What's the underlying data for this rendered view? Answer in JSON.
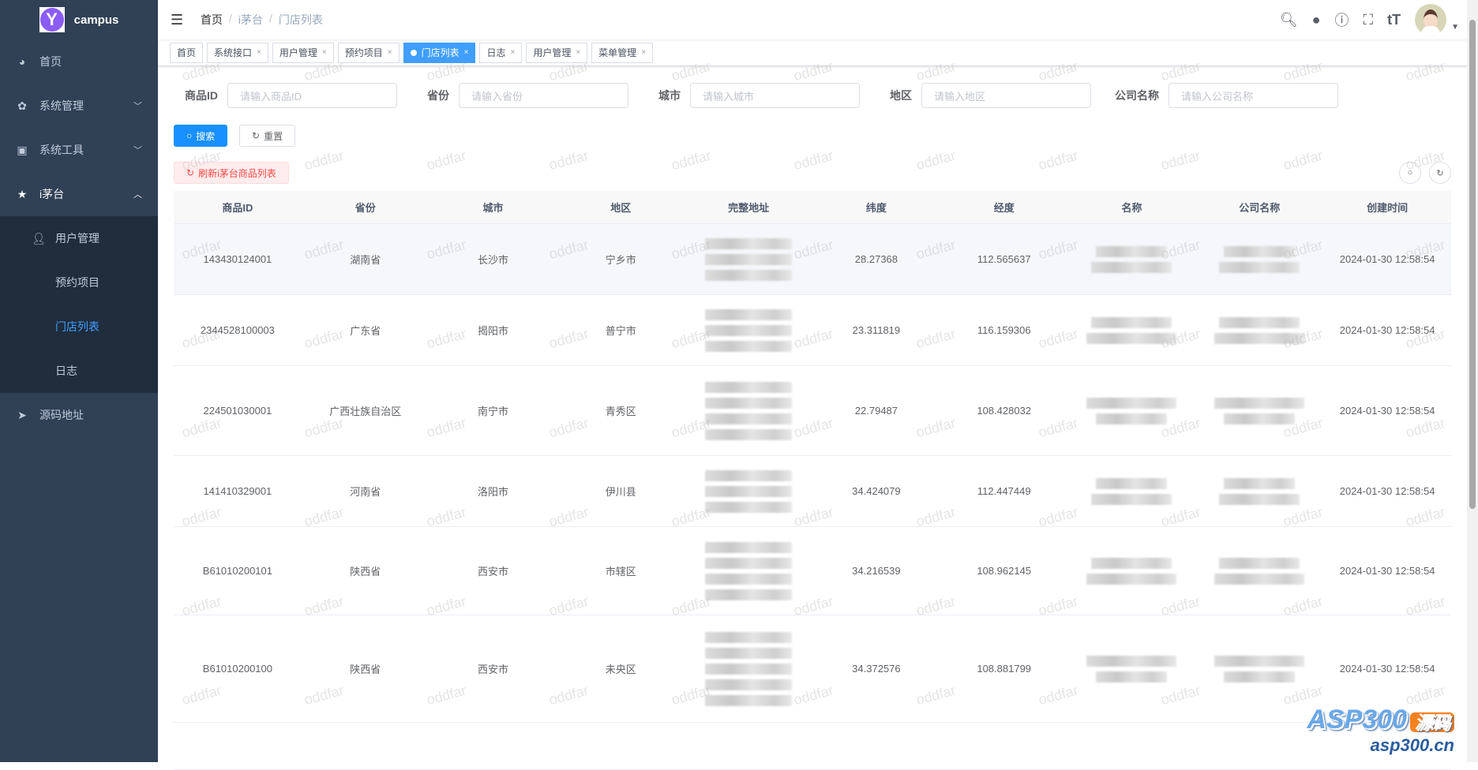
{
  "app": {
    "title": "campus",
    "logo_letter": "Y"
  },
  "sidebar": {
    "items": [
      {
        "label": "首页",
        "icon": "dashboard-icon"
      },
      {
        "label": "系统管理",
        "icon": "gear-icon"
      },
      {
        "label": "系统工具",
        "icon": "toolbox-icon"
      },
      {
        "label": "i茅台",
        "icon": "star-icon"
      },
      {
        "label": "源码地址",
        "icon": "send-icon"
      }
    ],
    "submenu": [
      {
        "label": "用户管理"
      },
      {
        "label": "预约项目"
      },
      {
        "label": "门店列表"
      },
      {
        "label": "日志"
      }
    ]
  },
  "breadcrumb": [
    "首页",
    "i茅台",
    "门店列表"
  ],
  "tags": [
    {
      "label": "首页"
    },
    {
      "label": "系统接口"
    },
    {
      "label": "用户管理"
    },
    {
      "label": "预约项目"
    },
    {
      "label": "门店列表"
    },
    {
      "label": "日志"
    },
    {
      "label": "用户管理"
    },
    {
      "label": "菜单管理"
    }
  ],
  "filters": [
    {
      "label": "商品ID",
      "placeholder": "请输入商品ID"
    },
    {
      "label": "省份",
      "placeholder": "请输入省份"
    },
    {
      "label": "城市",
      "placeholder": "请输入城市"
    },
    {
      "label": "地区",
      "placeholder": "请输入地区"
    },
    {
      "label": "公司名称",
      "placeholder": "请输入公司名称"
    }
  ],
  "buttons": {
    "search": "搜索",
    "reset": "重置",
    "refresh": "刷新i茅台商品列表"
  },
  "table": {
    "columns": [
      "商品ID",
      "省份",
      "城市",
      "地区",
      "完整地址",
      "纬度",
      "经度",
      "名称",
      "公司名称",
      "创建时间"
    ],
    "rows": [
      {
        "id": "143430124001",
        "province": "湖南省",
        "city": "长沙市",
        "district": "宁乡市",
        "lat": "28.27368",
        "lng": "112.565637",
        "created": "2024-01-30 12:58:54"
      },
      {
        "id": "2344528100003",
        "province": "广东省",
        "city": "揭阳市",
        "district": "普宁市",
        "lat": "23.311819",
        "lng": "116.159306",
        "created": "2024-01-30 12:58:54"
      },
      {
        "id": "224501030001",
        "province": "广西壮族自治区",
        "city": "南宁市",
        "district": "青秀区",
        "lat": "22.79487",
        "lng": "108.428032",
        "created": "2024-01-30 12:58:54"
      },
      {
        "id": "141410329001",
        "province": "河南省",
        "city": "洛阳市",
        "district": "伊川县",
        "lat": "34.424079",
        "lng": "112.447449",
        "created": "2024-01-30 12:58:54"
      },
      {
        "id": "B61010200101",
        "province": "陕西省",
        "city": "西安市",
        "district": "市辖区",
        "lat": "34.216539",
        "lng": "108.962145",
        "created": "2024-01-30 12:58:54"
      },
      {
        "id": "B61010200100",
        "province": "陕西省",
        "city": "西安市",
        "district": "未央区",
        "lat": "34.372576",
        "lng": "108.881799",
        "created": "2024-01-30 12:58:54"
      }
    ]
  },
  "watermark": "oddfar",
  "site_logo": {
    "text": "ASP300",
    "badge": "源码",
    "url": "asp300.cn"
  }
}
